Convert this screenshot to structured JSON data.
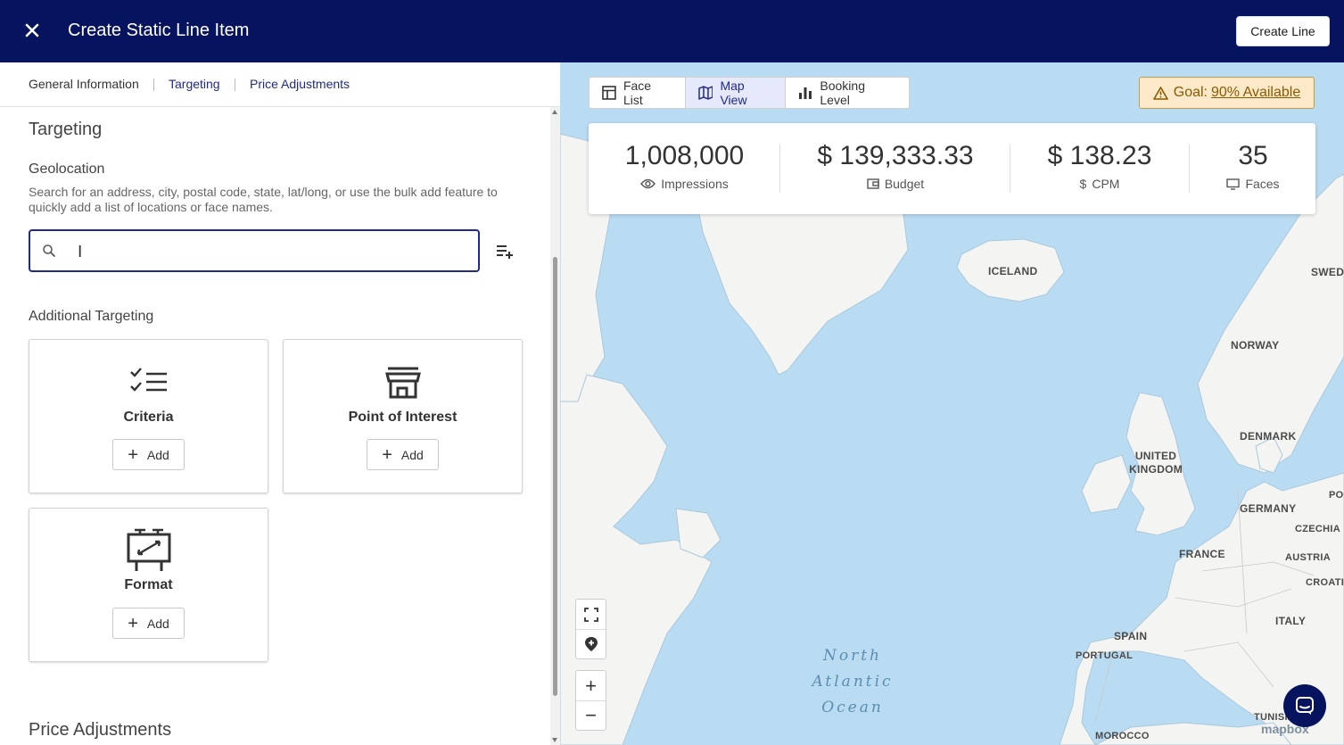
{
  "header": {
    "title": "Create Static Line Item",
    "create_button": "Create Line",
    "close_icon": "close-icon"
  },
  "tabs": [
    {
      "label": "General Information"
    },
    {
      "label": "Targeting"
    },
    {
      "label": "Price Adjustments"
    }
  ],
  "targeting": {
    "title": "Targeting",
    "geolocation": {
      "label": "Geolocation",
      "description": "Search for an address, city, postal code, state, lat/long, or use the bulk add feature to quickly add a list of locations or face names.",
      "search_value": "",
      "search_placeholder": ""
    },
    "additional_label": "Additional Targeting",
    "cards": [
      {
        "label": "Criteria",
        "icon": "checklist-icon",
        "add_label": "Add"
      },
      {
        "label": "Point of Interest",
        "icon": "storefront-icon",
        "add_label": "Add"
      },
      {
        "label": "Format",
        "icon": "billboard-icon",
        "add_label": "Add"
      }
    ]
  },
  "price_adjustments": {
    "title": "Price Adjustments"
  },
  "map": {
    "view_toggle": [
      {
        "label": "Face List",
        "icon": "table-icon"
      },
      {
        "label": "Map View",
        "icon": "map-icon",
        "active": true
      },
      {
        "label": "Booking Level",
        "icon": "bar-chart-icon"
      }
    ],
    "goal": {
      "prefix": "Goal:",
      "link": "90% Available",
      "icon": "warning-icon"
    },
    "stats": [
      {
        "value": "1,008,000",
        "label": "Impressions",
        "icon": "eye-icon"
      },
      {
        "value": "$ 139,333.33",
        "label": "Budget",
        "icon": "wallet-icon"
      },
      {
        "value": "$ 138.23",
        "label": "CPM",
        "icon": "dollar-icon"
      },
      {
        "value": "35",
        "label": "Faces",
        "icon": "screen-icon"
      }
    ],
    "labels": {
      "iceland": "ICELAND",
      "sweden": "SWEDI",
      "norway": "NORWAY",
      "denmark": "DENMARK",
      "uk_1": "UNITED",
      "uk_2": "KINGDOM",
      "germany": "GERMANY",
      "czechia": "CZECHIA",
      "france": "FRANCE",
      "austria": "AUSTRIA",
      "croatia": "CROATIA",
      "poland": "POL",
      "italy": "ITALY",
      "spain": "SPAIN",
      "portugal": "PORTUGAL",
      "tunisia": "TUNISIA",
      "morocco": "MOROCCO",
      "ocean_1": "North",
      "ocean_2": "Atlantic",
      "ocean_3": "Ocean"
    },
    "attribution": "mapbox",
    "colors": {
      "water": "#b9dcf3",
      "land": "#f4f4f2",
      "header": "#06135f"
    }
  }
}
